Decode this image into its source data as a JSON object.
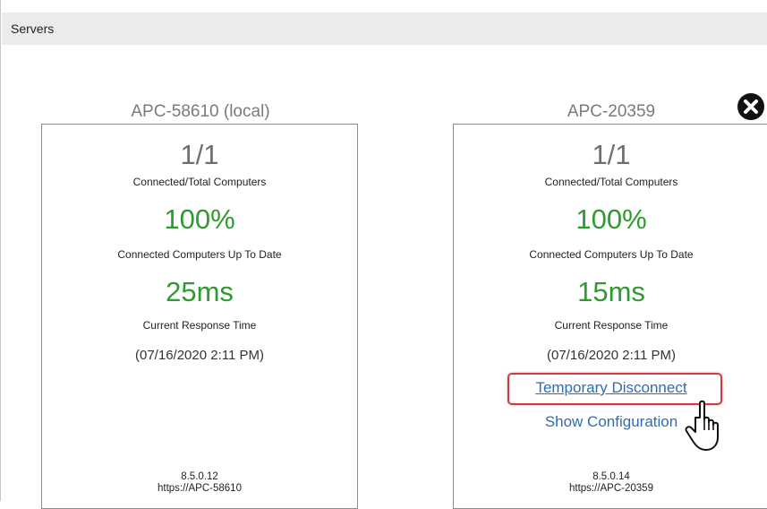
{
  "header": {
    "title": "Servers"
  },
  "servers": [
    {
      "name": "APC-58610 (local)",
      "connected_total": "1/1",
      "connected_total_label": "Connected/Total Computers",
      "up_to_date": "100%",
      "up_to_date_label": "Connected Computers Up To Date",
      "response_time": "25ms",
      "response_time_label": "Current Response Time",
      "timestamp": "(07/16/2020 2:11 PM)",
      "version": "8.5.0.12",
      "url": "https://APC-58610"
    },
    {
      "name": "APC-20359",
      "connected_total": "1/1",
      "connected_total_label": "Connected/Total Computers",
      "up_to_date": "100%",
      "up_to_date_label": "Connected Computers Up To Date",
      "response_time": "15ms",
      "response_time_label": "Current Response Time",
      "timestamp": "(07/16/2020 2:11 PM)",
      "temporary_disconnect_label": "Temporary Disconnect",
      "show_configuration_label": "Show Configuration",
      "version": "8.5.0.14",
      "url": "https://APC-20359"
    }
  ],
  "icons": {
    "close": "close-icon",
    "cursor": "hand-pointer-icon"
  },
  "colors": {
    "good": "#2f9a2f",
    "link": "#2d6db5",
    "highlight": "#d9363e"
  }
}
